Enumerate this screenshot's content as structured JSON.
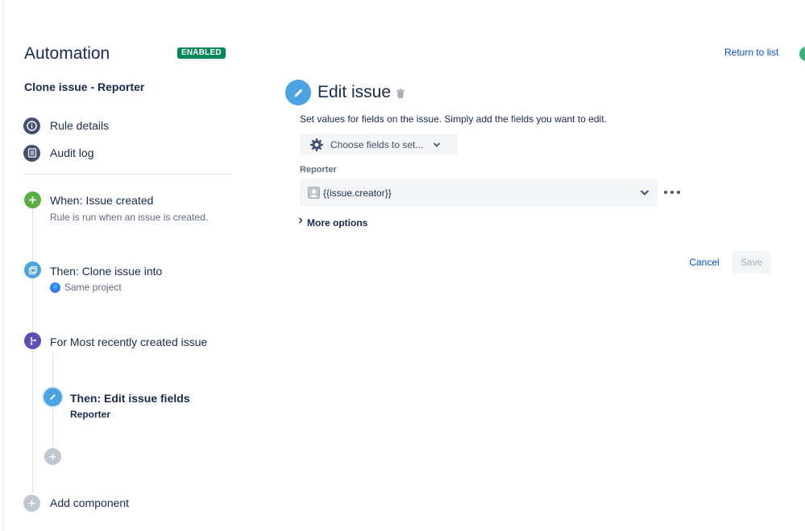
{
  "header": {
    "title": "Automation",
    "status": "ENABLED",
    "return_link": "Return to list"
  },
  "sidebar": {
    "rule_name": "Clone issue - Reporter",
    "nav": [
      {
        "label": "Rule details",
        "icon": "info-icon"
      },
      {
        "label": "Audit log",
        "icon": "audit-log-icon"
      }
    ],
    "components": [
      {
        "title": "When: Issue created",
        "subtitle": "Rule is run when an issue is created.",
        "icon": "plus-icon",
        "color": "#5aac44"
      },
      {
        "title": "Then: Clone issue into",
        "subtitle": "Same project",
        "icon": "clone-icon",
        "color": "#4ba3e0"
      },
      {
        "title": "For Most recently created issue",
        "icon": "branch-icon",
        "color": "#5e4db2"
      },
      {
        "title": "Then: Edit issue fields",
        "subtitle": "Reporter",
        "icon": "pencil-icon",
        "color": "#4ba3e0"
      }
    ],
    "add_component": "Add component"
  },
  "panel": {
    "title": "Edit issue",
    "description": "Set values for fields on the issue. Simply add the fields you want to edit.",
    "choose_fields": "Choose fields to set...",
    "field_label": "Reporter",
    "field_value": "{{issue.creator}}",
    "more_options": "More options",
    "cancel": "Cancel",
    "save": "Save"
  },
  "colors": {
    "accent": "#0052cc",
    "enabled": "#00875a",
    "edit_blue": "#4ba3e0",
    "trigger_green": "#5aac44",
    "branch_purple": "#5e4db2",
    "nav_icon": "#42526e",
    "disabled_gray": "#c1c7d0"
  }
}
